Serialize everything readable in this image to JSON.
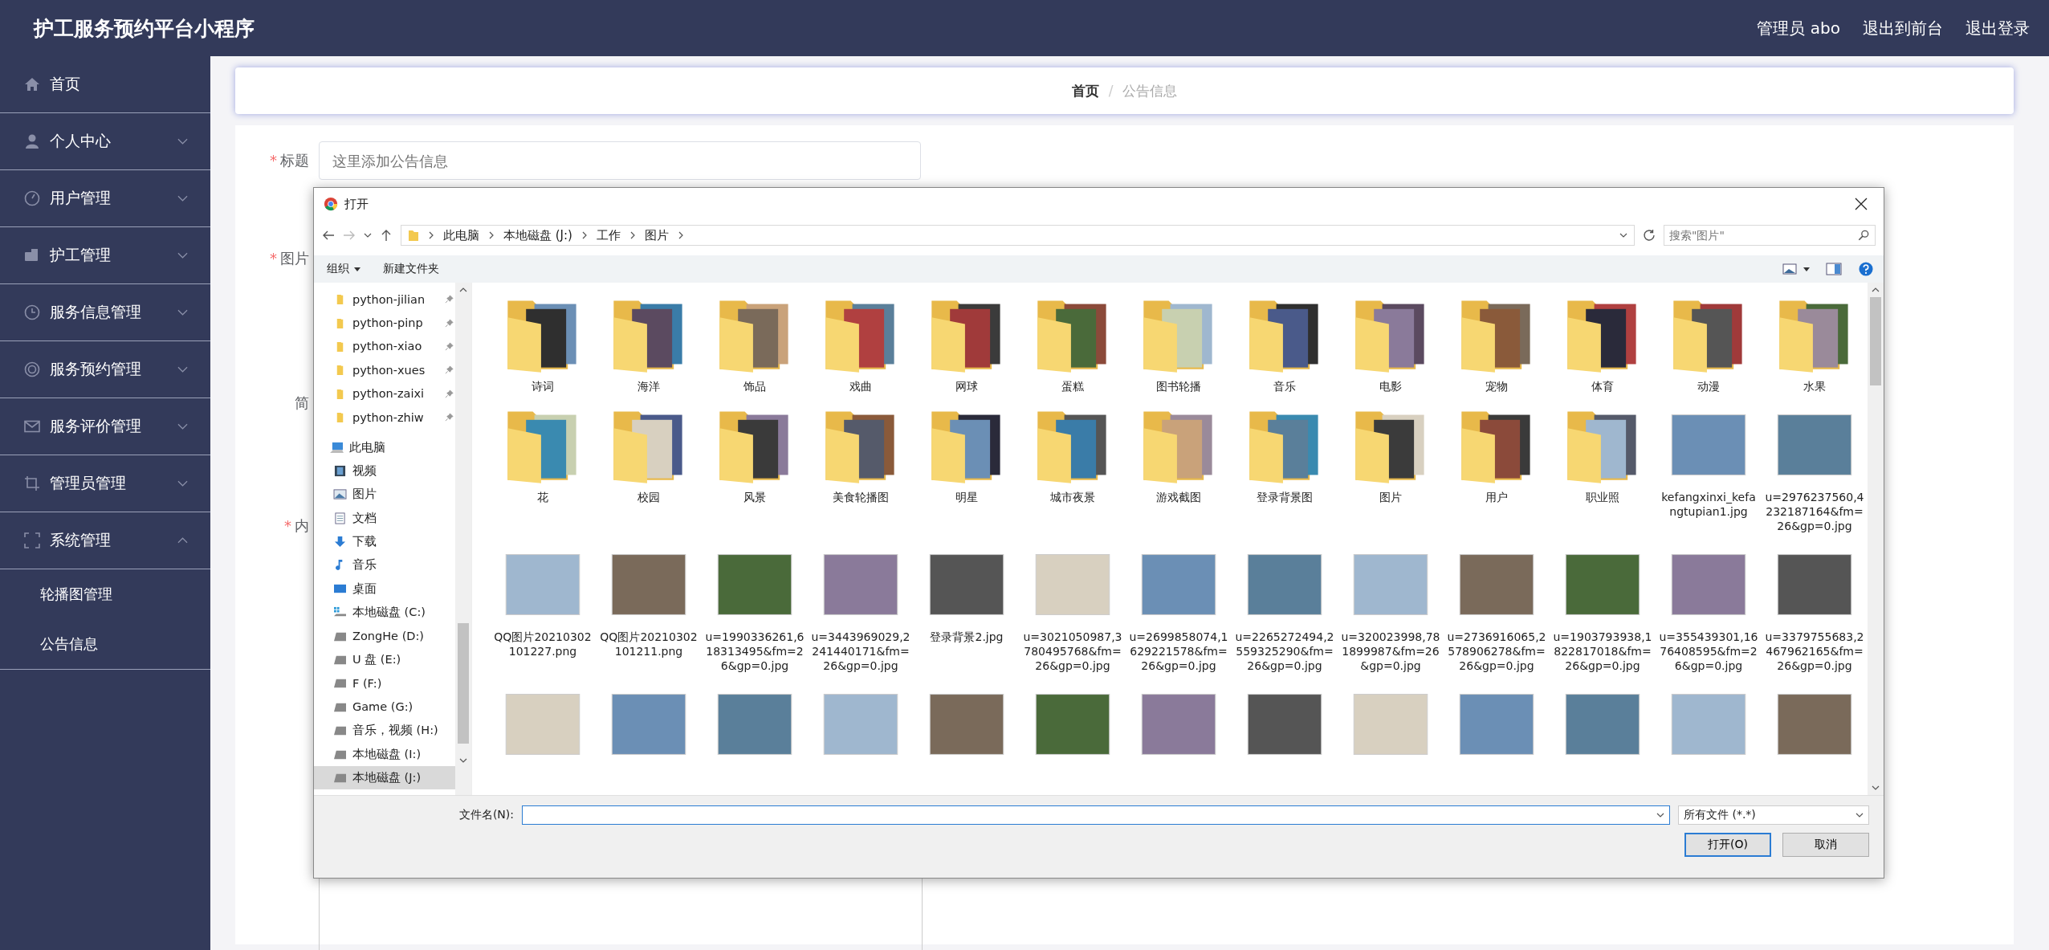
{
  "topbar": {
    "title": "护工服务预约平台小程序",
    "links": [
      "管理员 abo",
      "退出到前台",
      "退出登录"
    ]
  },
  "sidebar": {
    "items": [
      {
        "label": "首页",
        "kind": "home"
      },
      {
        "label": "个人中心",
        "kind": "user",
        "expanded": false
      },
      {
        "label": "用户管理",
        "kind": "gauge",
        "expanded": false
      },
      {
        "label": "护工管理",
        "kind": "wallet",
        "expanded": false
      },
      {
        "label": "服务信息管理",
        "kind": "clock",
        "expanded": false
      },
      {
        "label": "服务预约管理",
        "kind": "ring",
        "expanded": false
      },
      {
        "label": "服务评价管理",
        "kind": "mail",
        "expanded": false
      },
      {
        "label": "管理员管理",
        "kind": "crop",
        "expanded": false
      },
      {
        "label": "系统管理",
        "kind": "frame",
        "expanded": true,
        "children": [
          {
            "label": "轮播图管理"
          },
          {
            "label": "公告信息"
          }
        ]
      }
    ]
  },
  "breadcrumb": {
    "items": [
      "首页",
      "公告信息"
    ],
    "separator": "/"
  },
  "form": {
    "required_mark": "*",
    "fields": [
      {
        "label": "标题",
        "required": true,
        "kind": "text",
        "placeholder": "这里添加公告信息"
      },
      {
        "label": "图片",
        "required": true,
        "kind": "upload"
      },
      {
        "label": "简",
        "required": false,
        "kind": "textarea"
      },
      {
        "label": "内",
        "required": true,
        "kind": "editor"
      }
    ]
  },
  "dialog": {
    "title": "打开",
    "path": [
      "此电脑",
      "本地磁盘 (J:)",
      "工作",
      "图片"
    ],
    "search": {
      "placeholder": "搜索\"图片\""
    },
    "toolbar": [
      "组织",
      "新建文件夹"
    ],
    "nav": [
      {
        "label": "python-jilian",
        "kind": "folder",
        "pinned": true,
        "selected": false
      },
      {
        "label": "python-pinp",
        "kind": "folder",
        "pinned": true,
        "selected": false
      },
      {
        "label": "python-xiao",
        "kind": "folder",
        "pinned": true,
        "selected": false
      },
      {
        "label": "python-xues",
        "kind": "folder",
        "pinned": true,
        "selected": false
      },
      {
        "label": "python-zaixi",
        "kind": "folder",
        "pinned": true,
        "selected": false
      },
      {
        "label": "python-zhiw",
        "kind": "folder",
        "pinned": true,
        "selected": false
      },
      {
        "label": "此电脑",
        "kind": "pc",
        "selected": false,
        "children": [
          {
            "label": "视频",
            "kind": "video",
            "selected": false
          },
          {
            "label": "图片",
            "kind": "pictures",
            "selected": false
          },
          {
            "label": "文档",
            "kind": "docs",
            "selected": false
          },
          {
            "label": "下载",
            "kind": "download",
            "selected": false
          },
          {
            "label": "音乐",
            "kind": "music",
            "selected": false
          },
          {
            "label": "桌面",
            "kind": "desktop",
            "selected": false
          },
          {
            "label": "本地磁盘 (C:)",
            "kind": "sysdrive",
            "selected": false
          },
          {
            "label": "ZongHe (D:)",
            "kind": "drive",
            "selected": false
          },
          {
            "label": "U 盘 (E:)",
            "kind": "drive",
            "selected": false
          },
          {
            "label": "F (F:)",
            "kind": "drive",
            "selected": false
          },
          {
            "label": "Game (G:)",
            "kind": "drive",
            "selected": false
          },
          {
            "label": "音乐，视频 (H:)",
            "kind": "drive",
            "selected": false
          },
          {
            "label": "本地磁盘 (I:)",
            "kind": "drive",
            "selected": false
          },
          {
            "label": "本地磁盘 (J:)",
            "kind": "drive",
            "selected": true
          }
        ]
      }
    ],
    "files": [
      {
        "kind": "folder",
        "label": "诗词"
      },
      {
        "kind": "folder",
        "label": "海洋"
      },
      {
        "kind": "folder",
        "label": "饰品"
      },
      {
        "kind": "folder",
        "label": "戏曲"
      },
      {
        "kind": "folder",
        "label": "网球"
      },
      {
        "kind": "folder",
        "label": "蛋糕"
      },
      {
        "kind": "folder",
        "label": "图书轮播"
      },
      {
        "kind": "folder",
        "label": "音乐"
      },
      {
        "kind": "folder",
        "label": "电影"
      },
      {
        "kind": "folder",
        "label": "宠物"
      },
      {
        "kind": "folder",
        "label": "体育"
      },
      {
        "kind": "folder",
        "label": "动漫"
      },
      {
        "kind": "folder",
        "label": "水果"
      },
      {
        "kind": "folder",
        "label": "花"
      },
      {
        "kind": "folder",
        "label": "校园"
      },
      {
        "kind": "folder",
        "label": "风景"
      },
      {
        "kind": "folder",
        "label": "美食轮播图"
      },
      {
        "kind": "folder",
        "label": "明星"
      },
      {
        "kind": "folder",
        "label": "城市夜景"
      },
      {
        "kind": "folder",
        "label": "游戏截图"
      },
      {
        "kind": "folder",
        "label": "登录背景图"
      },
      {
        "kind": "folder",
        "label": "图片"
      },
      {
        "kind": "folder",
        "label": "用户"
      },
      {
        "kind": "folder",
        "label": "职业照"
      },
      {
        "kind": "image",
        "label": "kefangxinxi_kefangtupian1.jpg"
      },
      {
        "kind": "image",
        "label": "u=2976237560,4232187164&fm=26&gp=0.jpg"
      },
      {
        "kind": "image",
        "label": "QQ图片20210302101227.png"
      },
      {
        "kind": "image",
        "label": "QQ图片20210302101211.png"
      },
      {
        "kind": "image",
        "label": "u=1990336261,618313495&fm=26&gp=0.jpg"
      },
      {
        "kind": "image",
        "label": "u=3443969029,2241440171&fm=26&gp=0.jpg"
      },
      {
        "kind": "image",
        "label": "登录背景2.jpg"
      },
      {
        "kind": "image",
        "label": "u=3021050987,3780495768&fm=26&gp=0.jpg"
      },
      {
        "kind": "image",
        "label": "u=2699858074,1629221578&fm=26&gp=0.jpg"
      },
      {
        "kind": "image",
        "label": "u=2265272494,2559325290&fm=26&gp=0.jpg"
      },
      {
        "kind": "image",
        "label": "u=320023998,781899987&fm=26&gp=0.jpg"
      },
      {
        "kind": "image",
        "label": "u=2736916065,2578906278&fm=26&gp=0.jpg"
      },
      {
        "kind": "image",
        "label": "u=1903793938,1822817018&fm=26&gp=0.jpg"
      },
      {
        "kind": "image",
        "label": "u=355439301,1676408595&fm=26&gp=0.jpg"
      },
      {
        "kind": "image",
        "label": "u=3379755683,2467962165&fm=26&gp=0.jpg"
      },
      {
        "kind": "image"
      },
      {
        "kind": "image"
      },
      {
        "kind": "image"
      },
      {
        "kind": "image"
      },
      {
        "kind": "image"
      },
      {
        "kind": "image"
      },
      {
        "kind": "image"
      },
      {
        "kind": "image"
      },
      {
        "kind": "image"
      },
      {
        "kind": "image"
      },
      {
        "kind": "image"
      },
      {
        "kind": "image"
      },
      {
        "kind": "image"
      }
    ],
    "filename": {
      "label": "文件名(N):"
    },
    "filter": "所有文件 (*.*)",
    "buttons": [
      {
        "label": "打开(O)",
        "default": true
      },
      {
        "label": "取消",
        "default": false
      }
    ]
  }
}
